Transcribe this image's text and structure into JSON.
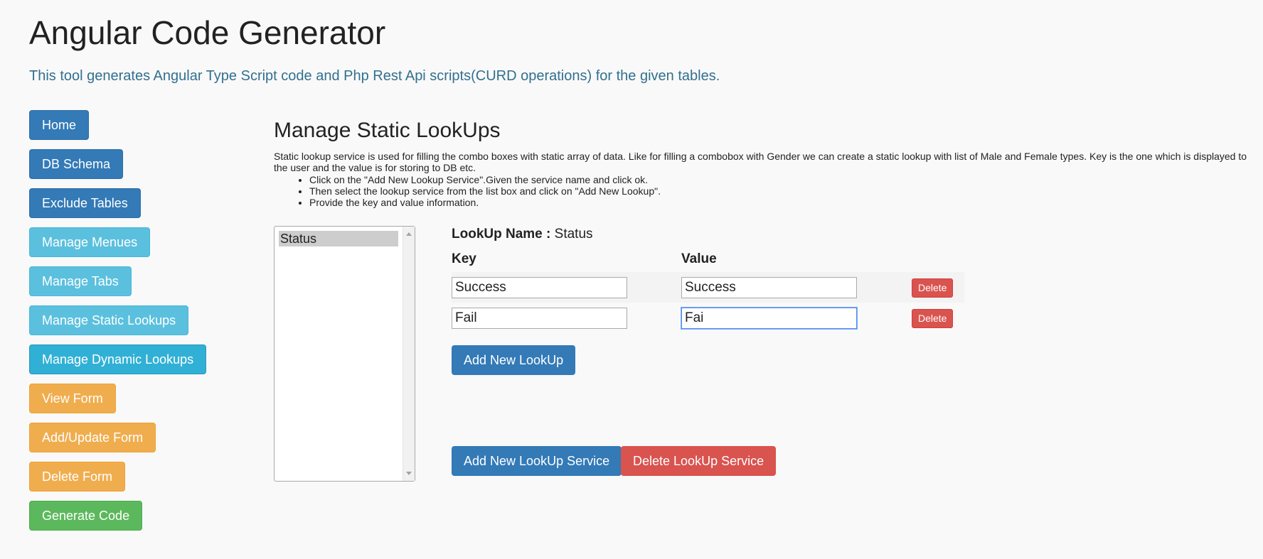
{
  "header": {
    "title": "Angular Code Generator",
    "description": "This tool generates Angular Type Script code and Php Rest Api scripts(CURD operations) for the given tables."
  },
  "sidebar": {
    "items": [
      {
        "label": "Home",
        "style": "primary",
        "color": "#337ab7"
      },
      {
        "label": "DB Schema",
        "style": "primary",
        "color": "#337ab7"
      },
      {
        "label": "Exclude Tables",
        "style": "primary",
        "color": "#337ab7"
      },
      {
        "label": "Manage Menues",
        "style": "info",
        "color": "#5bc0de"
      },
      {
        "label": "Manage Tabs",
        "style": "info",
        "color": "#5bc0de"
      },
      {
        "label": "Manage Static Lookups",
        "style": "info",
        "color": "#5bc0de"
      },
      {
        "label": "Manage Dynamic Lookups",
        "style": "info",
        "color": "#31b0d5"
      },
      {
        "label": "View Form",
        "style": "warning",
        "color": "#f0ad4e"
      },
      {
        "label": "Add/Update Form",
        "style": "warning",
        "color": "#f0ad4e"
      },
      {
        "label": "Delete Form",
        "style": "warning",
        "color": "#f0ad4e"
      },
      {
        "label": "Generate Code",
        "style": "success",
        "color": "#5cb85c"
      }
    ]
  },
  "main": {
    "title": "Manage Static LookUps",
    "intro": "Static lookup service is used for filling the combo boxes with static array of data. Like for filling a combobox with Gender we can create a static lookup with list of Male and Female types. Key is the one which is displayed to the user and the value is for storing to DB etc.",
    "steps": [
      "Click on the \"Add New Lookup Service\".Given the service name and click ok.",
      "Then select the lookup service from the list box and click on \"Add New Lookup\".",
      "Provide the key and value information."
    ],
    "services_list": {
      "items": [
        "Status"
      ],
      "selected": "Status"
    },
    "lookup": {
      "name_label": "LookUp Name :",
      "name_value": "Status",
      "columns": {
        "key": "Key",
        "value": "Value"
      },
      "rows": [
        {
          "key": "Success",
          "value": "Success",
          "delete_label": "Delete"
        },
        {
          "key": "Fail",
          "value": "Fai",
          "delete_label": "Delete"
        }
      ],
      "add_lookup_label": "Add New LookUp"
    },
    "actions": {
      "add_service_label": "Add New LookUp Service",
      "delete_service_label": "Delete LookUp Service"
    }
  },
  "colors": {
    "primary": "#337ab7",
    "danger": "#d9534f",
    "info_text": "#31708f"
  }
}
